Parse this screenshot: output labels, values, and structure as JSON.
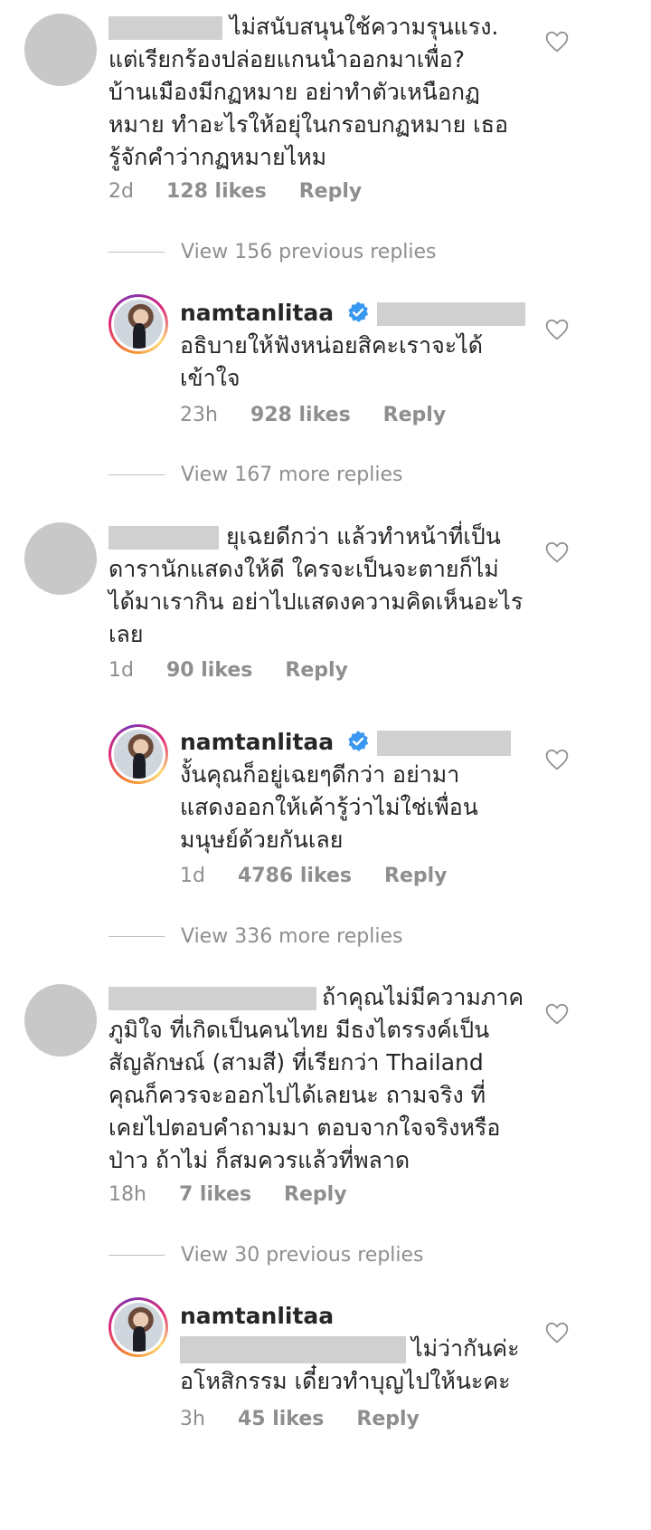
{
  "comments": [
    {
      "text": "ไม่สนับสนุนใช้ความรุนแรง. แต่เรียกร้องปล่อยแกนนำออกมาเพื่อ? บ้านเมืองมีกฏหมาย อย่าทำตัวเหนือกฏหมาย  ทำอะไรให้อยุ่ในกรอบกฏหมาย เธอรู้จักคำว่ากฏหมายไหม",
      "lines": [
        "ไม่สนับสนุนใช้ความรุนแรง.",
        "แต่เรียกร้องปล่อยแกนนำออกมาเพื่อ?",
        "บ้านเมืองมีกฏหมาย อย่าทำตัวเหนือกฏ",
        "หมาย  ทำอะไรให้อยุ่ในกรอบกฏหมาย เธอ",
        "รู้จักคำว่ากฏหมายไหม"
      ],
      "time": "2d",
      "likes": "128 likes",
      "reply": "Reply",
      "view_replies": "View 156 previous replies",
      "reply_item": {
        "username": "namtanlitaa",
        "lines": [
          "อธิบายให้ฟังหน่อยสิคะเราจะได้",
          "เข้าใจ"
        ],
        "time": "23h",
        "likes": "928 likes",
        "reply": "Reply"
      },
      "view_more": "View 167 more replies"
    },
    {
      "lines": [
        "ยุเฉยดีกว่า แล้วทำหน้าที่เป็น",
        "ดารานักแสดงให้ดี ใครจะเป็นจะตายก็ไม่",
        "ได้มาเรากิน อย่าไปแสดงความคิดเห็นอะไร",
        "เลย"
      ],
      "time": "1d",
      "likes": "90 likes",
      "reply": "Reply",
      "reply_item": {
        "username": "namtanlitaa",
        "lines": [
          "งั้นคุณก็อยู่เฉยๆดีกว่า อย่ามา",
          "แสดงออกให้เค้ารู้ว่าไม่ใช่เพื่อน",
          "มนุษย์ด้วยกันเลย"
        ],
        "time": "1d",
        "likes": "4786 likes",
        "reply": "Reply"
      },
      "view_more": "View 336 more replies"
    },
    {
      "lines": [
        "ถ้าคุณไม่มีความภาค",
        "ภูมิใจ ที่เกิดเป็นคนไทย มีธงไตรรงค์เป็น",
        "สัญลักษณ์ (สามสี) ที่เรียกว่า Thailand",
        "คุณก็ควรจะออกไปได้เลยนะ ถามจริง ที่",
        "เคยไปตอบคำถามมา ตอบจากใจจริงหรือ",
        "ป่าว ถ้าไม่ ก็สมควรแล้วที่พลาด"
      ],
      "time": "18h",
      "likes": "7 likes",
      "reply": "Reply",
      "view_replies": "View 30 previous replies",
      "reply_item": {
        "username": "namtanlitaa",
        "lines": [
          "ไม่ว่ากันค่ะ",
          "อโหสิกรรม เดี๋ยวทำบุญไปให้นะคะ"
        ],
        "time": "3h",
        "likes": "45 likes",
        "reply": "Reply"
      }
    }
  ],
  "icons": {
    "heart": "heart-outline-icon",
    "verified": "verified-badge-icon"
  },
  "colors": {
    "text": "#262626",
    "meta": "#8e8e8e",
    "verified": "#3897f0",
    "redact": "#d0d0d0"
  }
}
